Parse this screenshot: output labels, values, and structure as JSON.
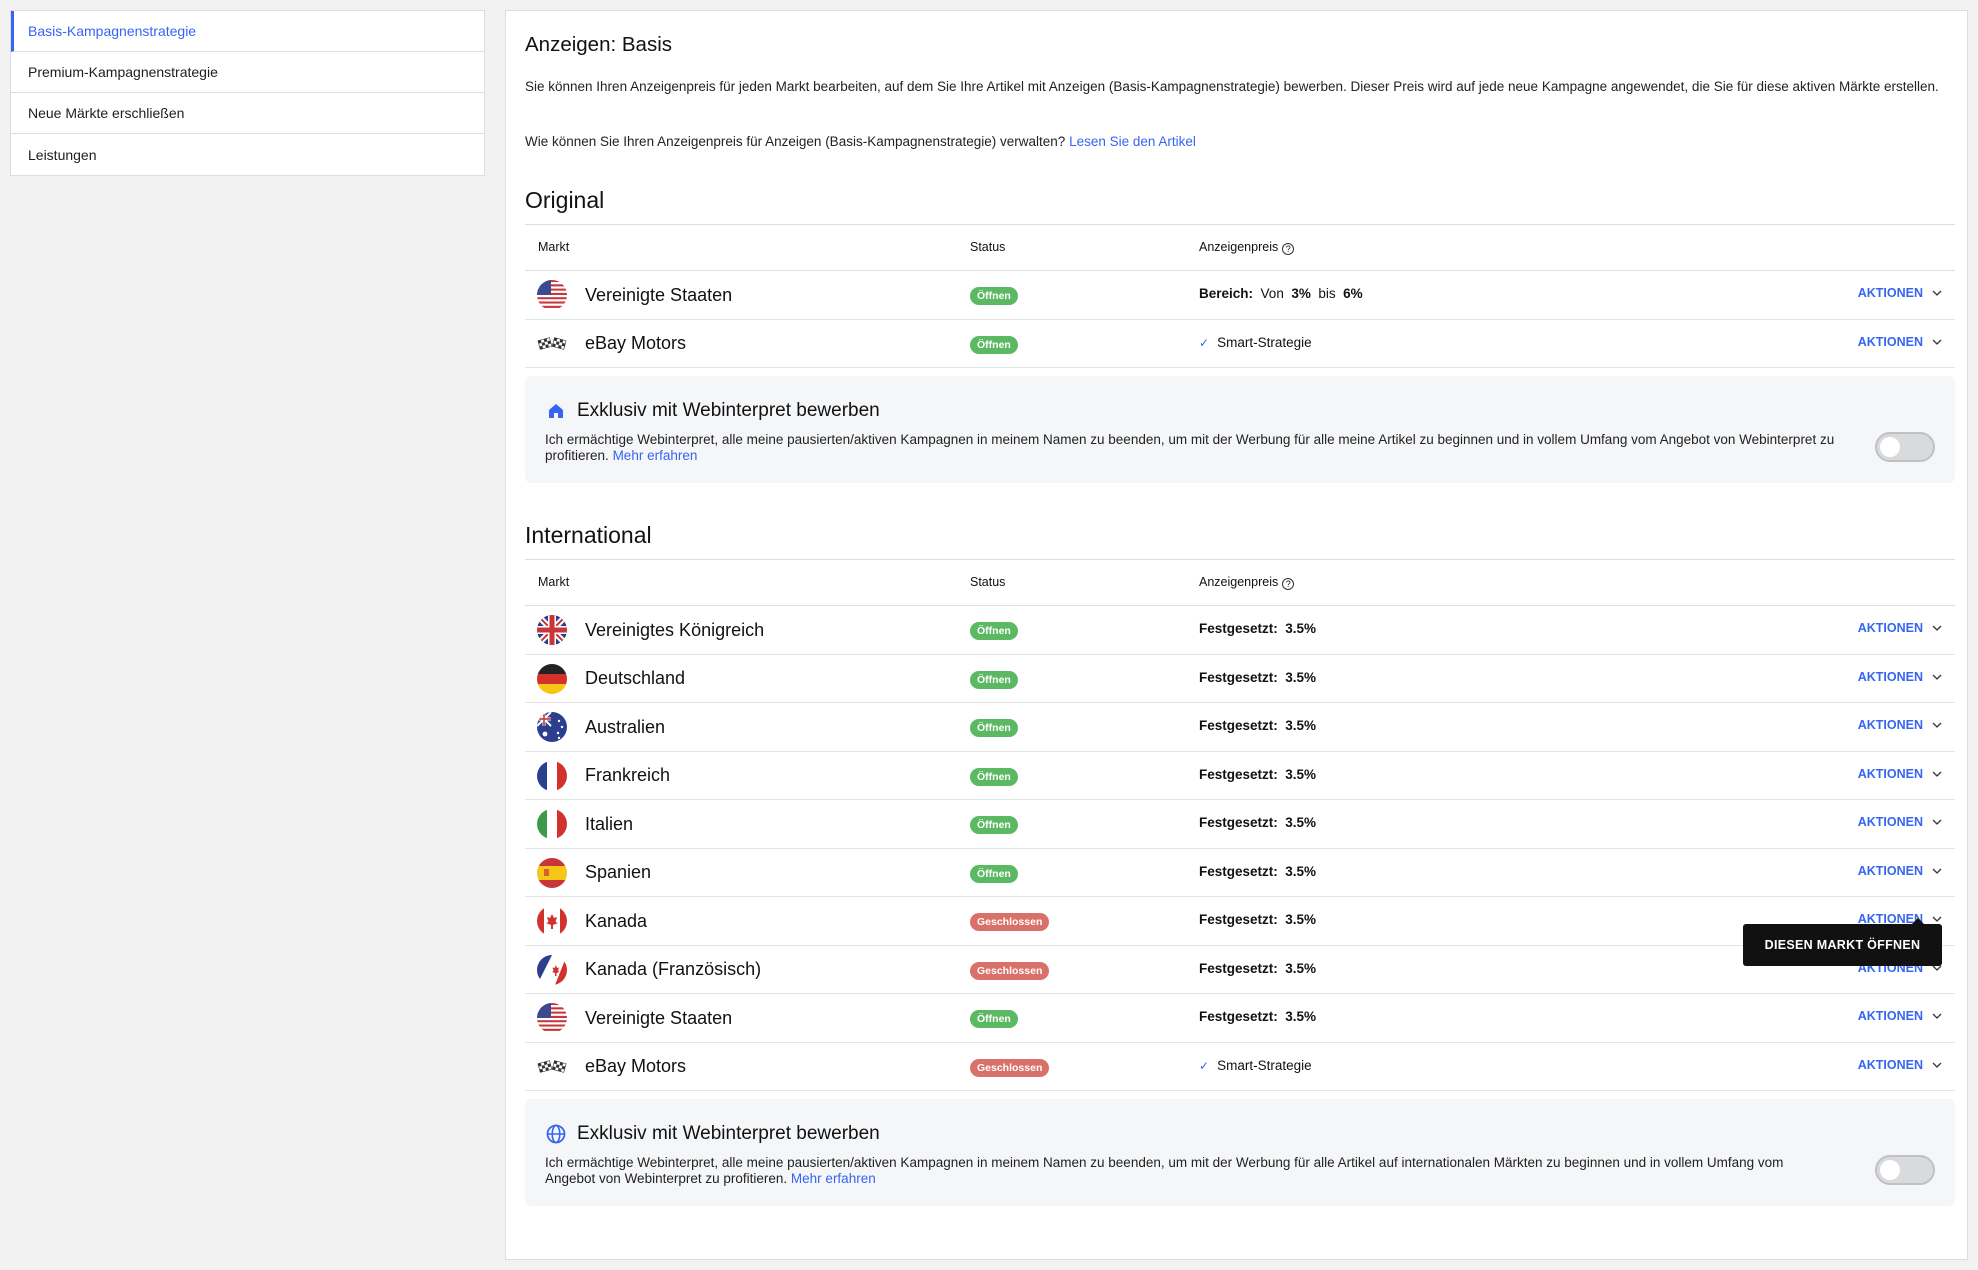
{
  "sidebar": {
    "items": [
      {
        "label": "Basis-Kampagnenstrategie",
        "active": true
      },
      {
        "label": "Premium-Kampagnenstrategie"
      },
      {
        "label": "Neue Märkte erschließen"
      },
      {
        "label": "Leistungen"
      }
    ]
  },
  "page": {
    "title": "Anzeigen: Basis",
    "description": "Sie können Ihren Anzeigenpreis für jeden Markt bearbeiten, auf dem Sie Ihre Artikel mit Anzeigen (Basis-Kampagnenstrategie) bewerben. Dieser Preis wird auf jede neue Kampagne angewendet, die Sie für diese aktiven Märkte erstellen.",
    "question": "Wie können Sie Ihren Anzeigenpreis für Anzeigen (Basis-Kampagnenstrategie) verwalten?",
    "question_link": "Lesen Sie den Artikel"
  },
  "columns": {
    "market": "Markt",
    "status": "Status",
    "price": "Anzeigenpreis"
  },
  "original": {
    "title": "Original",
    "rows": [
      {
        "flag": "us-flag-icon",
        "market": "Vereinigte Staaten",
        "status": "Öffnen",
        "price_label": "Bereich:",
        "price_from": "Von",
        "price_min": "3%",
        "price_to": "bis",
        "price_max": "6%",
        "action": "AKTIONEN"
      },
      {
        "flag": "checkered-flags-icon",
        "market": "eBay Motors",
        "status": "Öffnen",
        "price_text": "Smart-Strategie",
        "action": "AKTIONEN"
      }
    ],
    "promo": {
      "title": "Exklusiv mit Webinterpret bewerben",
      "text": "Ich ermächtige Webinterpret, alle meine pausierten/aktiven Kampagnen in meinem Namen zu beenden, um mit der Werbung für alle meine Artikel zu beginnen und in vollem Umfang vom Angebot von Webinterpret zu profitieren.",
      "link": "Mehr erfahren"
    }
  },
  "international": {
    "title": "International",
    "rows": [
      {
        "flag": "uk-flag-icon",
        "market": "Vereinigtes Königreich",
        "status": "Öffnen",
        "price_label": "Festgesetzt:",
        "price_value": "3.5%",
        "action": "AKTIONEN"
      },
      {
        "flag": "de-flag-icon",
        "market": "Deutschland",
        "status": "Öffnen",
        "price_label": "Festgesetzt:",
        "price_value": "3.5%",
        "action": "AKTIONEN"
      },
      {
        "flag": "au-flag-icon",
        "market": "Australien",
        "status": "Öffnen",
        "price_label": "Festgesetzt:",
        "price_value": "3.5%",
        "action": "AKTIONEN"
      },
      {
        "flag": "fr-flag-icon",
        "market": "Frankreich",
        "status": "Öffnen",
        "price_label": "Festgesetzt:",
        "price_value": "3.5%",
        "action": "AKTIONEN"
      },
      {
        "flag": "it-flag-icon",
        "market": "Italien",
        "status": "Öffnen",
        "price_label": "Festgesetzt:",
        "price_value": "3.5%",
        "action": "AKTIONEN"
      },
      {
        "flag": "es-flag-icon",
        "market": "Spanien",
        "status": "Öffnen",
        "price_label": "Festgesetzt:",
        "price_value": "3.5%",
        "action": "AKTIONEN"
      },
      {
        "flag": "ca-flag-icon",
        "market": "Kanada",
        "status": "Geschlossen",
        "price_label": "Festgesetzt:",
        "price_value": "3.5%",
        "action": "AKTIONEN"
      },
      {
        "flag": "ca-fr-flag-icon",
        "market": "Kanada (Französisch)",
        "status": "Geschlossen",
        "price_label": "Festgesetzt:",
        "price_value": "3.5%",
        "action": "AKTIONEN"
      },
      {
        "flag": "us-flag-icon",
        "market": "Vereinigte Staaten",
        "status": "Öffnen",
        "price_label": "Festgesetzt:",
        "price_value": "3.5%",
        "action": "AKTIONEN"
      },
      {
        "flag": "checkered-flags-icon",
        "market": "eBay Motors",
        "status": "Geschlossen",
        "price_text": "Smart-Strategie",
        "action": "AKTIONEN"
      }
    ],
    "promo": {
      "title": "Exklusiv mit Webinterpret bewerben",
      "text": "Ich ermächtige Webinterpret, alle meine pausierten/aktiven Kampagnen in meinem Namen zu beenden, um mit der Werbung für alle Artikel auf internationalen Märkten zu beginnen und in vollem Umfang vom Angebot von Webinterpret zu profitieren.",
      "link": "Mehr erfahren"
    }
  },
  "tooltip": {
    "label": "DIESEN MARKT ÖFFNEN"
  },
  "colors": {
    "accent": "#3665f3",
    "open": "#5bb863",
    "closed": "#d9706a"
  }
}
